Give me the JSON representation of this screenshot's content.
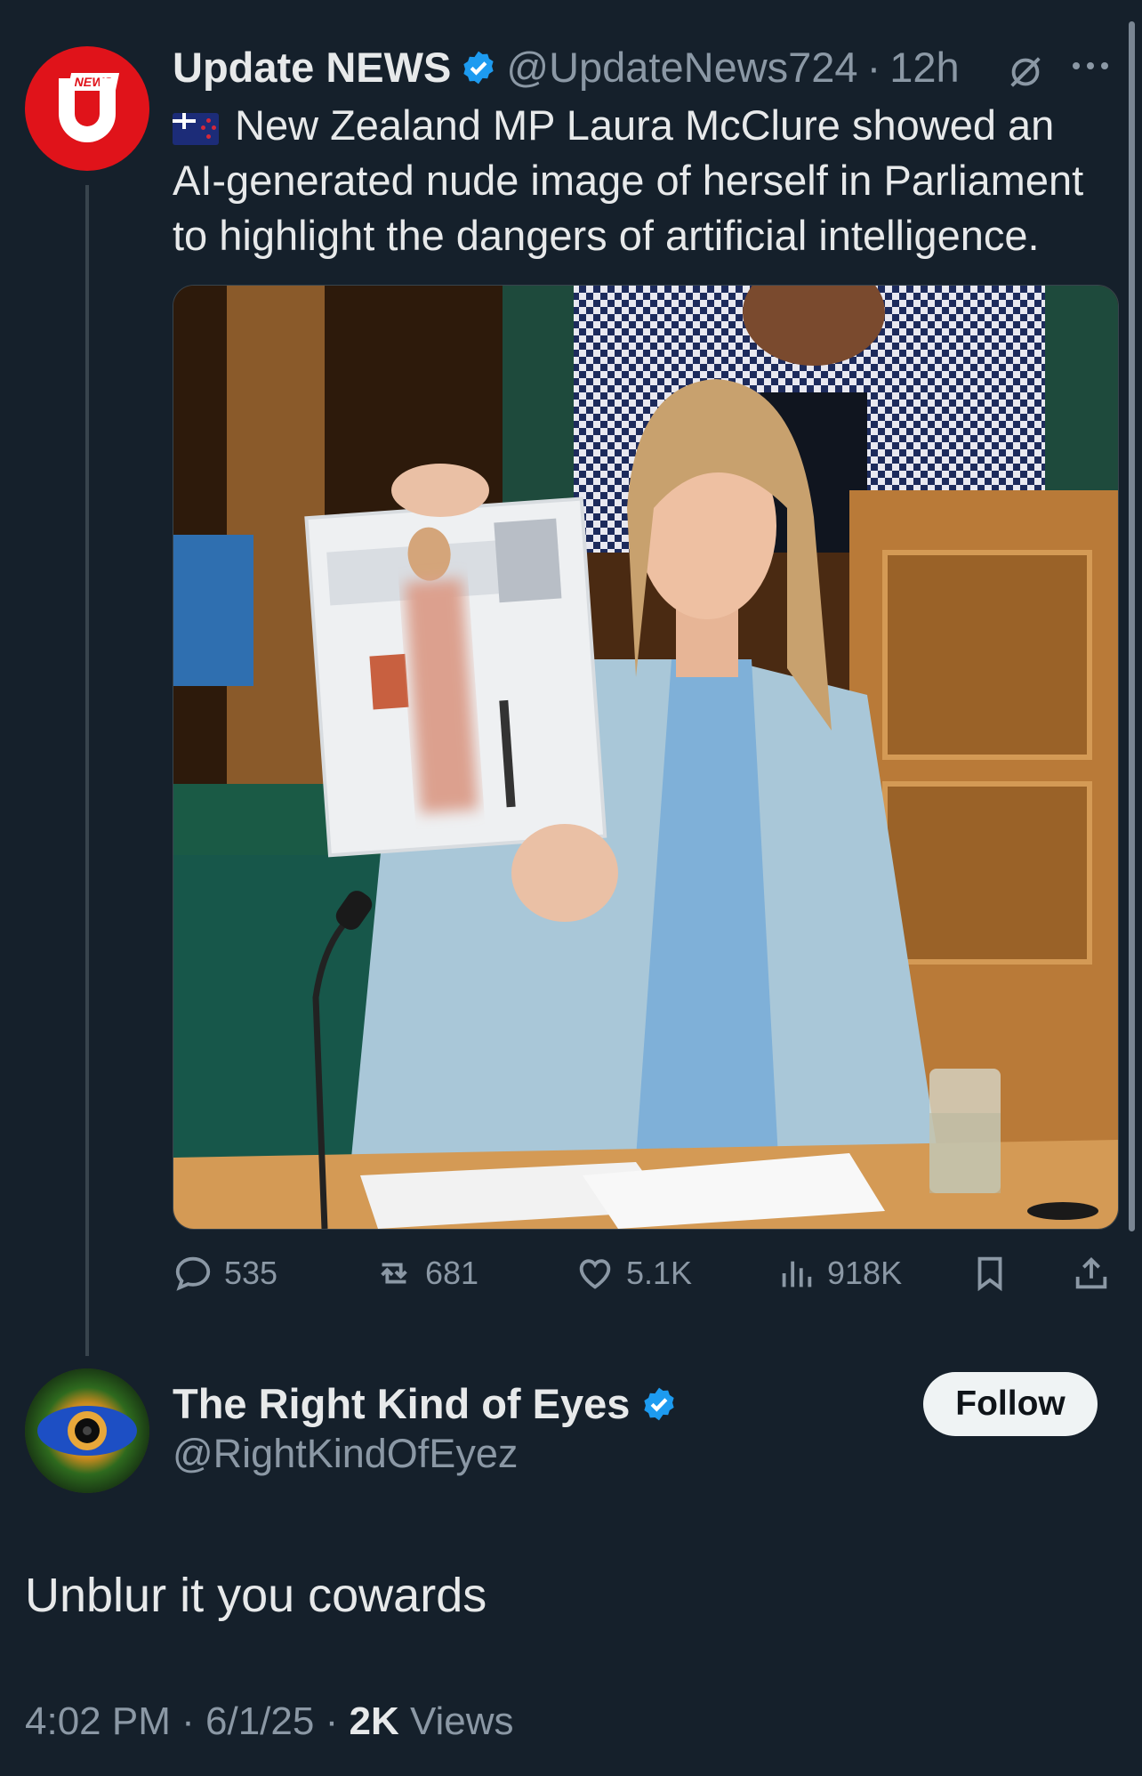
{
  "tweet": {
    "author_name": "Update NEWS",
    "author_handle": "@UpdateNews724",
    "separator": "·",
    "time": "12h",
    "avatar_text": "NEWS",
    "text": "New Zealand MP Laura McClure showed an AI-generated nude image of herself in Parliament to highlight the dangers of artificial intelligence.",
    "stats": {
      "replies": "535",
      "reposts": "681",
      "likes": "5.1K",
      "views": "918K"
    }
  },
  "reply": {
    "author_name": "The Right Kind of Eyes",
    "author_handle": "@RightKindOfEyez",
    "follow_label": "Follow",
    "text": "Unblur it you cowards",
    "time": "4:02 PM",
    "date": "6/1/25",
    "separator": "·",
    "views_count": "2K",
    "views_label": "Views"
  },
  "colors": {
    "background": "#15202b",
    "verified": "#1d9bf0",
    "muted": "#8b98a5",
    "brand_red": "#e0131a"
  },
  "icons": [
    "verified-badge-icon",
    "grok-icon",
    "more-icon",
    "reply-icon",
    "repost-icon",
    "like-icon",
    "views-icon",
    "bookmark-icon",
    "share-icon"
  ]
}
